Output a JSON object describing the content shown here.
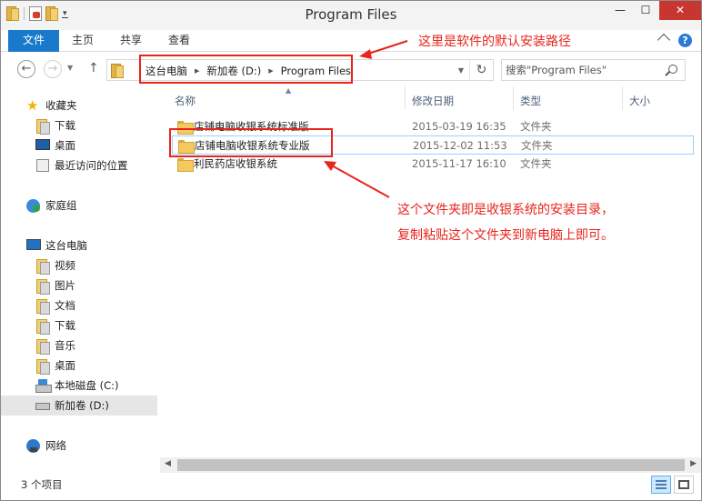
{
  "titlebar": {
    "title": "Program Files"
  },
  "ribbon": {
    "file": "文件",
    "home": "主页",
    "share": "共享",
    "view": "查看"
  },
  "address": {
    "crumbs": [
      "这台电脑",
      "新加卷 (D:)",
      "Program Files"
    ]
  },
  "search": {
    "placeholder": "搜索\"Program Files\""
  },
  "navpane": {
    "favorites": "收藏夹",
    "downloads": "下载",
    "desktop": "桌面",
    "recent": "最近访问的位置",
    "homegroup": "家庭组",
    "thispc": "这台电脑",
    "videos": "视频",
    "pictures": "图片",
    "documents": "文档",
    "downloads2": "下载",
    "music": "音乐",
    "desktop2": "桌面",
    "drive_c": "本地磁盘 (C:)",
    "drive_d": "新加卷 (D:)",
    "network": "网络"
  },
  "columns": {
    "name": "名称",
    "date": "修改日期",
    "type": "类型",
    "size": "大小"
  },
  "files": [
    {
      "name": "店铺电脑收银系统标准版",
      "date": "2015-03-19 16:35",
      "type": "文件夹"
    },
    {
      "name": "店铺电脑收银系统专业版",
      "date": "2015-12-02 11:53",
      "type": "文件夹"
    },
    {
      "name": "利民药店收银系统",
      "date": "2015-11-17 16:10",
      "type": "文件夹"
    }
  ],
  "status": {
    "count": "3 个项目"
  },
  "annotations": {
    "path_note": "这里是软件的默认安装路径",
    "folder_note_line1": "这个文件夹即是收银系统的安装目录，",
    "folder_note_line2": "复制粘贴这个文件夹到新电脑上即可。",
    "color": "#e8241b"
  }
}
